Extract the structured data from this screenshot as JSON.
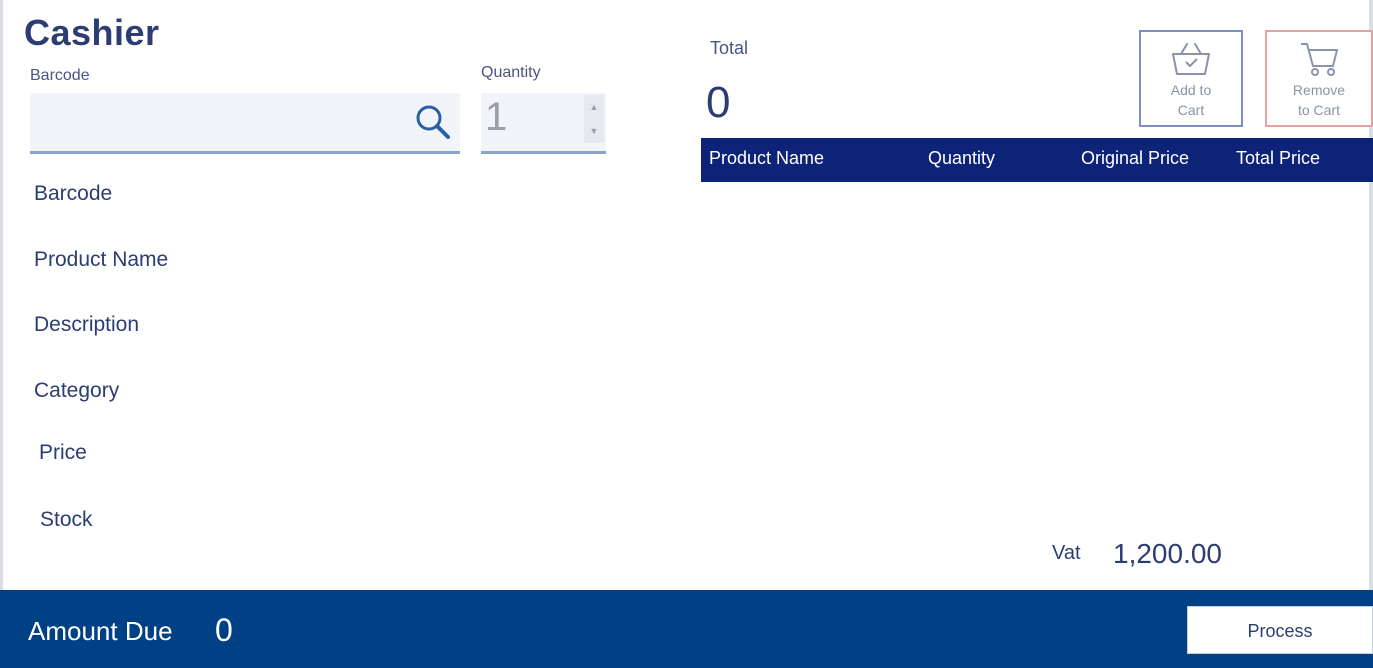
{
  "app": {
    "title": "Cashier"
  },
  "search": {
    "barcode_label": "Barcode",
    "barcode_value": "",
    "quantity_label": "Quantity",
    "quantity_value": "1"
  },
  "details": {
    "fields": [
      {
        "label": "Barcode"
      },
      {
        "label": "Product Name"
      },
      {
        "label": "Description"
      },
      {
        "label": "Category"
      },
      {
        "label": "Price"
      },
      {
        "label": "Stock"
      }
    ]
  },
  "summary": {
    "total_label": "Total",
    "total_value": "0",
    "vat_label": "Vat",
    "vat_value": "1,200.00"
  },
  "cart_buttons": {
    "add": {
      "line1": "Add to",
      "line2": "Cart",
      "icon": "basket-icon"
    },
    "remove": {
      "line1": "Remove",
      "line2": "to Cart",
      "icon": "cart-icon"
    }
  },
  "table": {
    "columns": [
      "Product Name",
      "Quantity",
      "Original Price",
      "Total Price"
    ],
    "rows": []
  },
  "footer": {
    "amount_due_label": "Amount Due",
    "amount_due_value": "0",
    "process_label": "Process"
  },
  "colors": {
    "header_blue": "#0d2377",
    "footer_blue": "#004084",
    "text_blue": "#2c3d73"
  }
}
